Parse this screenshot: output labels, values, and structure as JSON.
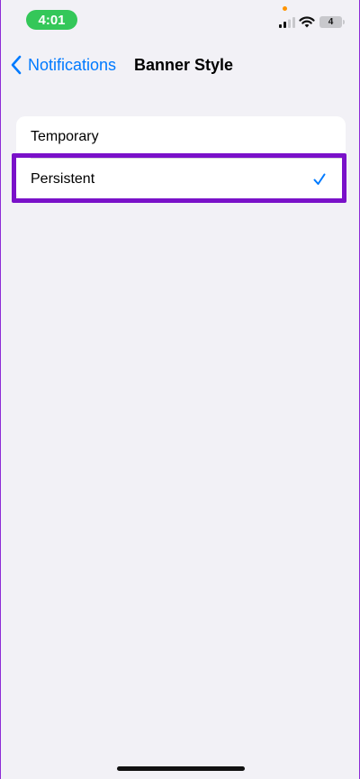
{
  "status_bar": {
    "time": "4:01",
    "battery_level": "4",
    "icons": [
      "signal-icon",
      "wifi-icon",
      "battery-icon",
      "privacy-indicator-dot"
    ]
  },
  "nav": {
    "back_label": "Notifications",
    "title": "Banner Style"
  },
  "options": [
    {
      "label": "Temporary",
      "selected": false
    },
    {
      "label": "Persistent",
      "selected": true
    }
  ],
  "colors": {
    "accent": "#007aff",
    "background": "#f2f1f6",
    "highlight_outline": "#7a11c9",
    "time_pill": "#34c759"
  }
}
